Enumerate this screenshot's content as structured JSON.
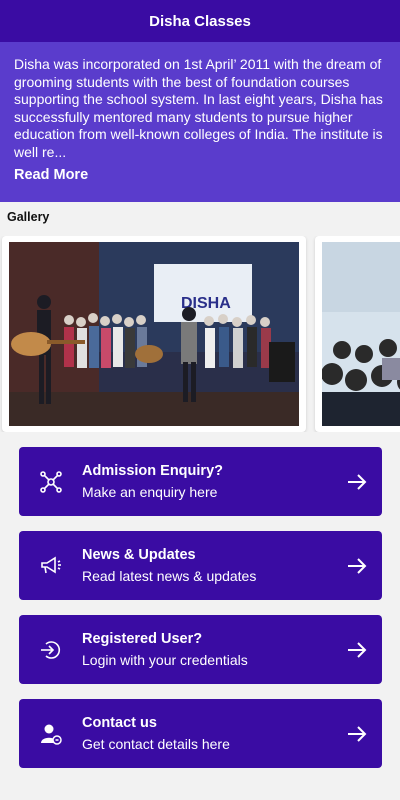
{
  "appbar": {
    "title": "Disha Classes"
  },
  "about": {
    "text": "Disha was incorporated on 1st April’ 2011 with the dream of grooming students with the best of foundation courses supporting the school system. In last eight years, Disha has successfully mentored many students to pursue higher education from well-known colleges of India. The institute is well re...",
    "read_more": "Read More"
  },
  "gallery": {
    "title": "Gallery",
    "banner_text": "DISHA"
  },
  "actions": [
    {
      "title": "Admission Enquiry?",
      "subtitle": "Make an enquiry here",
      "icon": "network-icon"
    },
    {
      "title": "News & Updates",
      "subtitle": "Read latest news & updates",
      "icon": "megaphone-icon"
    },
    {
      "title": "Registered User?",
      "subtitle": "Login with your credentials",
      "icon": "login-icon"
    },
    {
      "title": "Contact us",
      "subtitle": "Get contact details here",
      "icon": "contact-icon"
    }
  ],
  "colors": {
    "primary": "#3a0ca3",
    "about_bg": "#5a3ccc",
    "background": "#f2f2f2"
  }
}
